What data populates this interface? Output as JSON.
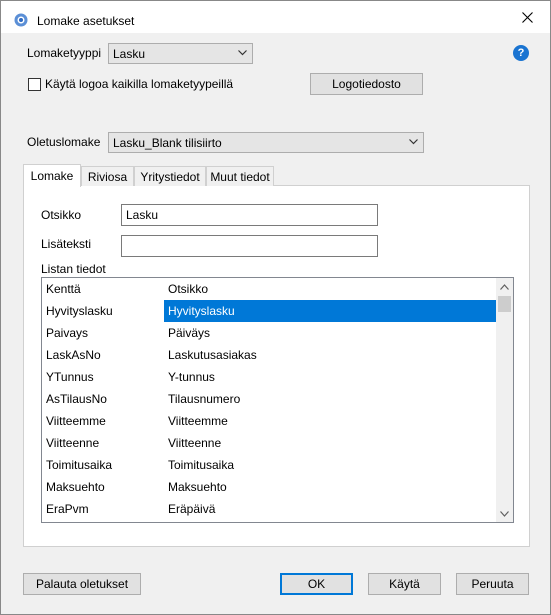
{
  "window": {
    "title": "Lomake asetukset"
  },
  "form_type": {
    "label": "Lomaketyyppi",
    "value": "Lasku"
  },
  "logo": {
    "checkbox_label": "Käytä logoa kaikilla lomaketyypeillä",
    "checked": false,
    "file_button": "Logotiedosto"
  },
  "default_form": {
    "label": "Oletuslomake",
    "value": "Lasku_Blank tilisiirto"
  },
  "tabs": [
    {
      "label": "Lomake",
      "active": true
    },
    {
      "label": "Riviosa",
      "active": false
    },
    {
      "label": "Yritystiedot",
      "active": false
    },
    {
      "label": "Muut tiedot",
      "active": false
    }
  ],
  "lomake_tab": {
    "title_label": "Otsikko",
    "title_value": "Lasku",
    "extra_label": "Lisäteksti",
    "extra_value": "",
    "list_label": "Listan tiedot",
    "columns": [
      "Kenttä",
      "Otsikko"
    ],
    "rows": [
      [
        "Hyvityslasku",
        "Hyvityslasku"
      ],
      [
        "Paivays",
        "Päiväys"
      ],
      [
        "LaskAsNo",
        "Laskutusasiakas"
      ],
      [
        "YTunnus",
        "Y-tunnus"
      ],
      [
        "AsTilausNo",
        "Tilausnumero"
      ],
      [
        "Viitteemme",
        "Viitteemme"
      ],
      [
        "Viitteenne",
        "Viitteenne"
      ],
      [
        "Toimitusaika",
        "Toimitusaika"
      ],
      [
        "Maksuehto",
        "Maksuehto"
      ],
      [
        "EraPvm",
        "Eräpäivä"
      ]
    ],
    "selected_row": 0
  },
  "buttons": {
    "reset": "Palauta oletukset",
    "ok": "OK",
    "apply": "Käytä",
    "cancel": "Peruuta"
  },
  "colors": {
    "accent": "#0078d7",
    "help": "#1a74d1"
  }
}
